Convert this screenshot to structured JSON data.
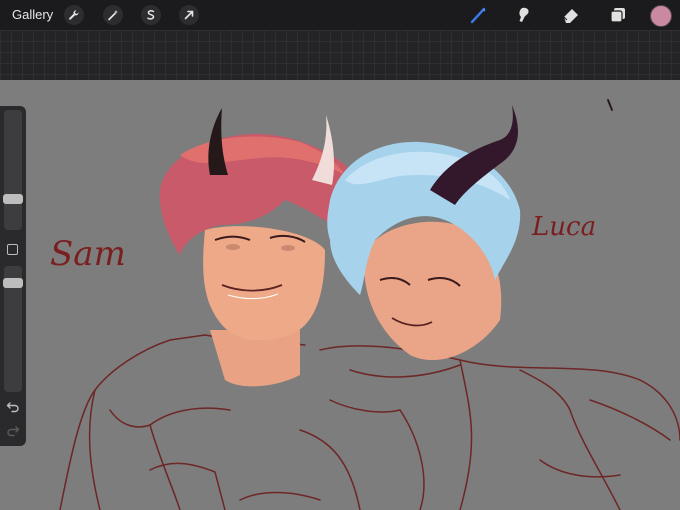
{
  "topbar": {
    "gallery_label": "Gallery",
    "left_tools": [
      {
        "name": "wrench-icon"
      },
      {
        "name": "magic-wand-icon"
      },
      {
        "name": "selection-icon"
      },
      {
        "name": "transform-arrow-icon"
      }
    ],
    "right_tools": [
      {
        "name": "brush-icon",
        "color": "#3c78e6"
      },
      {
        "name": "smudge-icon",
        "color": "#e0e0e0"
      },
      {
        "name": "eraser-icon",
        "color": "#e0e0e0"
      },
      {
        "name": "layers-icon",
        "color": "#e0e0e0"
      }
    ],
    "current_color": "#c98aa1"
  },
  "sidebar": {
    "brush_size_level": 0.35,
    "opacity_level": 0.95,
    "icons": [
      "modify-square-icon",
      "undo-icon",
      "redo-icon"
    ]
  },
  "artwork": {
    "label_left": "Sam",
    "label_right": "Luca",
    "text_color": "#7a1f1f"
  }
}
